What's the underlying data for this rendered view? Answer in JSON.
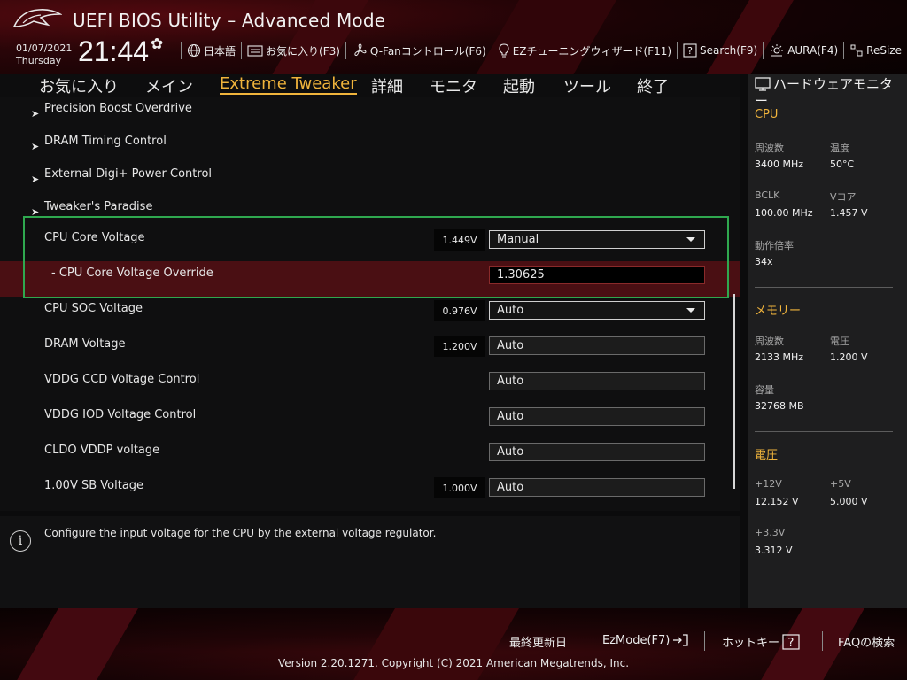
{
  "header": {
    "title": "UEFI BIOS Utility – Advanced Mode",
    "date": "01/07/2021",
    "day": "Thursday",
    "time": "21:44",
    "toolbar": [
      {
        "name": "language",
        "label": "日本語",
        "icon": "globe-icon"
      },
      {
        "name": "favorites",
        "label": "お気に入り(F3)",
        "icon": "favorites-icon"
      },
      {
        "name": "qfan",
        "label": "Q-Fanコントロール(F6)",
        "icon": "fan-icon"
      },
      {
        "name": "ez-tuning",
        "label": "EZチューニングウィザード(F11)",
        "icon": "lightbulb-icon"
      },
      {
        "name": "search",
        "label": "Search(F9)",
        "icon": "help-icon"
      },
      {
        "name": "aura",
        "label": "AURA(F4)",
        "icon": "aura-icon"
      },
      {
        "name": "resize",
        "label": "ReSize",
        "icon": "resize-icon"
      }
    ]
  },
  "nav": {
    "tabs": [
      {
        "label": "お気に入り"
      },
      {
        "label": "メイン"
      },
      {
        "label": "Extreme Tweaker",
        "active": true
      },
      {
        "label": "詳細"
      },
      {
        "label": "モニタ"
      },
      {
        "label": "起動"
      },
      {
        "label": "ツール"
      },
      {
        "label": "終了"
      }
    ]
  },
  "settings": {
    "submenus": [
      "Precision Boost Overdrive",
      "DRAM Timing Control",
      "External Digi+ Power Control",
      "Tweaker's Paradise"
    ],
    "rows": [
      {
        "label": "CPU Core Voltage",
        "voltage": "1.449V",
        "value": "Manual"
      },
      {
        "label": "- CPU Core Voltage Override",
        "value": "1.30625"
      },
      {
        "label": "CPU SOC Voltage",
        "voltage": "0.976V",
        "value": "Auto"
      },
      {
        "label": "DRAM Voltage",
        "voltage": "1.200V",
        "value": "Auto"
      },
      {
        "label": "VDDG CCD Voltage Control",
        "value": "Auto"
      },
      {
        "label": "VDDG IOD Voltage Control",
        "value": "Auto"
      },
      {
        "label": "CLDO VDDP voltage",
        "value": "Auto"
      },
      {
        "label": "1.00V SB Voltage",
        "voltage": "1.000V",
        "value": "Auto"
      }
    ]
  },
  "help": {
    "icon": "info-icon",
    "text": "Configure the input voltage for the CPU by the external voltage regulator."
  },
  "hardware_monitor": {
    "title": "ハードウェアモニター",
    "cpu": {
      "section": "CPU",
      "freq_label": "周波数",
      "freq": "3400 MHz",
      "temp_label": "温度",
      "temp": "50°C",
      "bclk_label": "BCLK",
      "bclk": "100.00 MHz",
      "vcore_label": "Vコア",
      "vcore": "1.457 V",
      "ratio_label": "動作倍率",
      "ratio": "34x"
    },
    "memory": {
      "section": "メモリー",
      "freq_label": "周波数",
      "freq": "2133 MHz",
      "volt_label": "電圧",
      "volt": "1.200 V",
      "cap_label": "容量",
      "cap": "32768 MB"
    },
    "voltage": {
      "section": "電圧",
      "v12_label": "+12V",
      "v12": "12.152 V",
      "v5_label": "+5V",
      "v5": "5.000 V",
      "v33_label": "+3.3V",
      "v33": "3.312 V"
    }
  },
  "footer": {
    "last_modified": "最終更新日",
    "ezmode": "EzMode(F7)",
    "hotkeys": "ホットキー",
    "faq": "FAQの検索",
    "copyright": "Version 2.20.1271. Copyright (C) 2021 American Megatrends, Inc."
  },
  "colors": {
    "accent": "#f0b43c",
    "highlight_row": "#4a0f13",
    "annotation_box": "#2fa84f"
  }
}
